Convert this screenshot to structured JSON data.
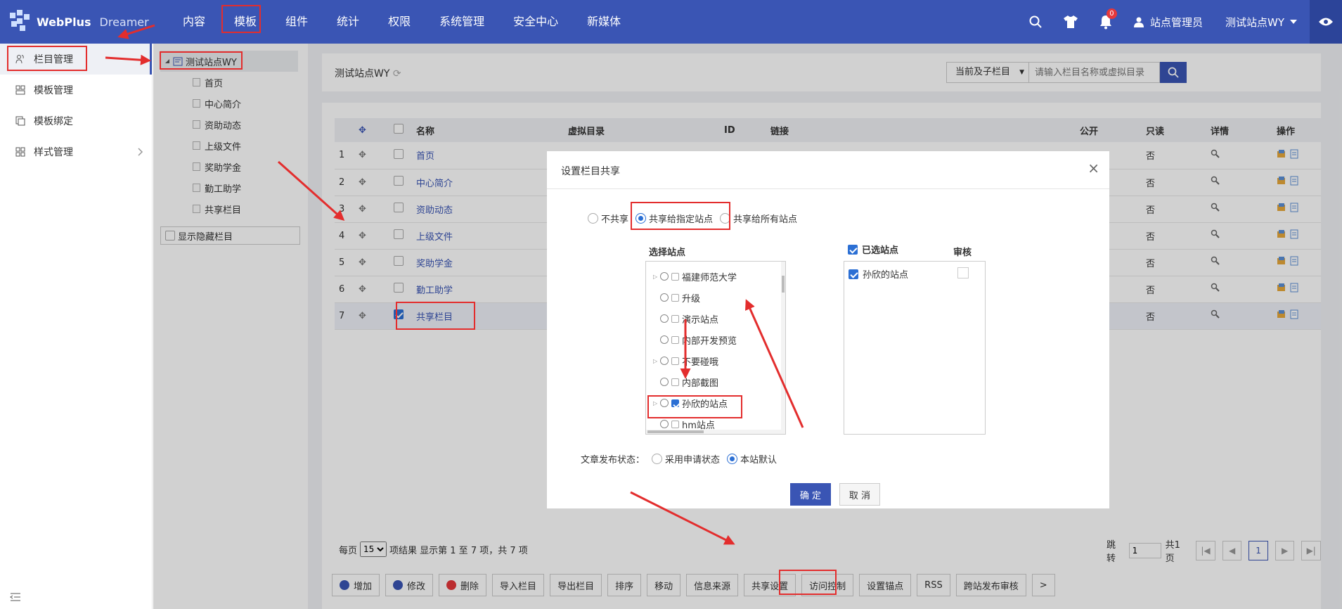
{
  "app": {
    "logo_text": "WebPlus",
    "logo_sub": "Dreamer"
  },
  "topnav": [
    "内容",
    "模板",
    "组件",
    "统计",
    "权限",
    "系统管理",
    "安全中心",
    "新媒体"
  ],
  "topright": {
    "badge_count": "0",
    "user": "站点管理员",
    "site": "测试站点WY"
  },
  "leftmenu": [
    "栏目管理",
    "模板管理",
    "模板绑定",
    "样式管理"
  ],
  "tree": {
    "root": "测试站点WY",
    "children": [
      "首页",
      "中心简介",
      "资助动态",
      "上级文件",
      "奖助学金",
      "勤工助学",
      "共享栏目"
    ],
    "show_hidden": "显示隐藏栏目"
  },
  "main": {
    "site_title": "测试站点WY",
    "scope": "当前及子栏目",
    "search_placeholder": "请输入栏目名称或虚拟目录"
  },
  "table": {
    "headers": [
      "名称",
      "虚拟目录",
      "ID",
      "链接",
      "公开",
      "只读",
      "详情",
      "操作"
    ],
    "rows": [
      {
        "no": "1",
        "name": "首页"
      },
      {
        "no": "2",
        "name": "中心简介"
      },
      {
        "no": "3",
        "name": "资助动态"
      },
      {
        "no": "4",
        "name": "上级文件"
      },
      {
        "no": "5",
        "name": "奖助学金"
      },
      {
        "no": "6",
        "name": "勤工助学"
      },
      {
        "no": "7",
        "name": "共享栏目"
      }
    ],
    "partial_cell": "否"
  },
  "pager": {
    "per_page_label": "每页",
    "per_page": "15",
    "summary": "项结果 显示第 1 至 7 项，共 7 项",
    "jump_label": "跳转",
    "jump_value": "1",
    "total_pages": "共1页",
    "current": "1"
  },
  "actions": [
    "增加",
    "修改",
    "删除",
    "导入栏目",
    "导出栏目",
    "排序",
    "移动",
    "信息来源",
    "共享设置",
    "访问控制",
    "设置锚点",
    "RSS",
    "跨站发布审核",
    ">"
  ],
  "modal": {
    "title": "设置栏目共享",
    "options": [
      "不共享",
      "共享给指定站点",
      "共享给所有站点"
    ],
    "select_sites_title": "选择站点",
    "sites": [
      "福建师范大学",
      "升级",
      "演示站点",
      "内部开发预览",
      "不要碰哦",
      "内部截图",
      "孙欣的站点",
      "hm站点"
    ],
    "chosen_title": "已选站点",
    "audit_title": "审核",
    "chosen_sites": [
      "孙欣的站点"
    ],
    "pub_status_label": "文章发布状态：",
    "pub_options": [
      "采用申请状态",
      "本站默认"
    ],
    "ok": "确 定",
    "cancel": "取 消"
  },
  "colors": {
    "topbar": "#3a55b4",
    "accent": "#2b6fd4",
    "annotation": "#e32d2d"
  }
}
